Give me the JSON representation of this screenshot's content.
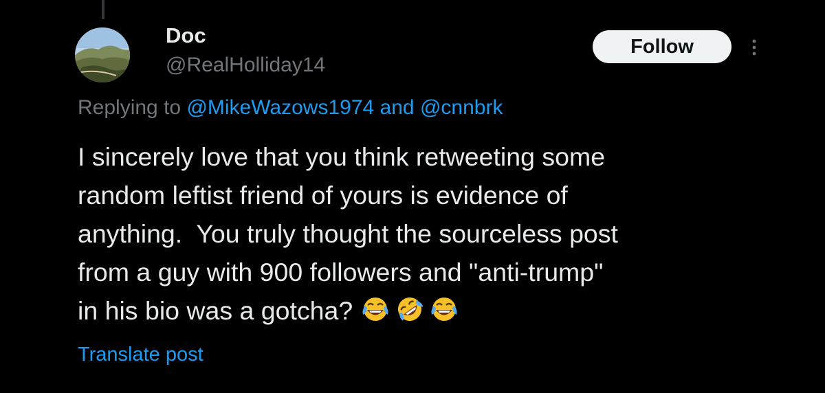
{
  "tweet": {
    "author": {
      "display_name": "Doc",
      "handle": "@RealHolliday14",
      "avatar": "landscape-avatar"
    },
    "follow_label": "Follow",
    "more_icon": "more-vertical-icon",
    "replying": {
      "prefix": "Replying to ",
      "mention_1": "@MikeWazows1974",
      "conjunction": " and ",
      "mention_2": "@cnnbrk"
    },
    "text_lines": [
      "I sincerely love that you think retweeting some",
      "random leftist friend of yours is evidence of",
      "anything.  You truly thought the sourceless post",
      "from a guy with 900 followers and \"anti-trump\"",
      "in his bio was a gotcha? "
    ],
    "emojis": [
      "tears-of-joy-emoji",
      "rolling-on-floor-laughing-emoji",
      "tears-of-joy-emoji"
    ],
    "translate_label": "Translate post"
  },
  "colors": {
    "background": "#000000",
    "primary_text": "#e7e9ea",
    "secondary_text": "#71767b",
    "link": "#1d9bf0",
    "follow_bg": "#eff3f4",
    "follow_text": "#0f1419"
  }
}
